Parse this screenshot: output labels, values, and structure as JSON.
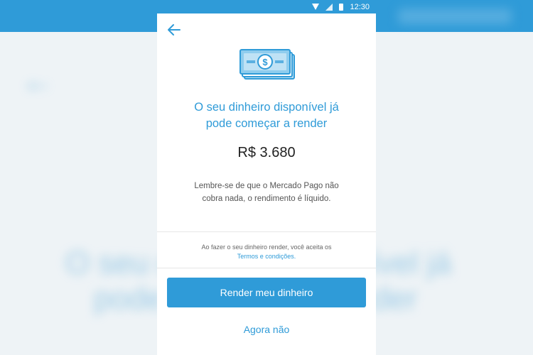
{
  "status_bar": {
    "time": "12:30"
  },
  "screen": {
    "title_line1": "O seu dinheiro disponível já",
    "title_line2": "pode começar a render",
    "amount": "R$ 3.680",
    "note_line1": "Lembre-se de que o Mercado Pago não",
    "note_line2": "cobra nada, o rendimento é líquido.",
    "terms_text": "Ao fazer o seu dinheiro render, você aceita os",
    "terms_link": "Termos e condições.",
    "primary_button": "Render meu dinheiro",
    "secondary_button": "Agora não"
  },
  "background": {
    "big_line1": "O seu dinheiro disponível já",
    "big_line2": "pode começar a render"
  },
  "colors": {
    "accent": "#2f9bd8",
    "text": "#222222",
    "muted": "#555555"
  },
  "icons": {
    "back": "arrow-left-icon",
    "money": "banknote-icon"
  }
}
